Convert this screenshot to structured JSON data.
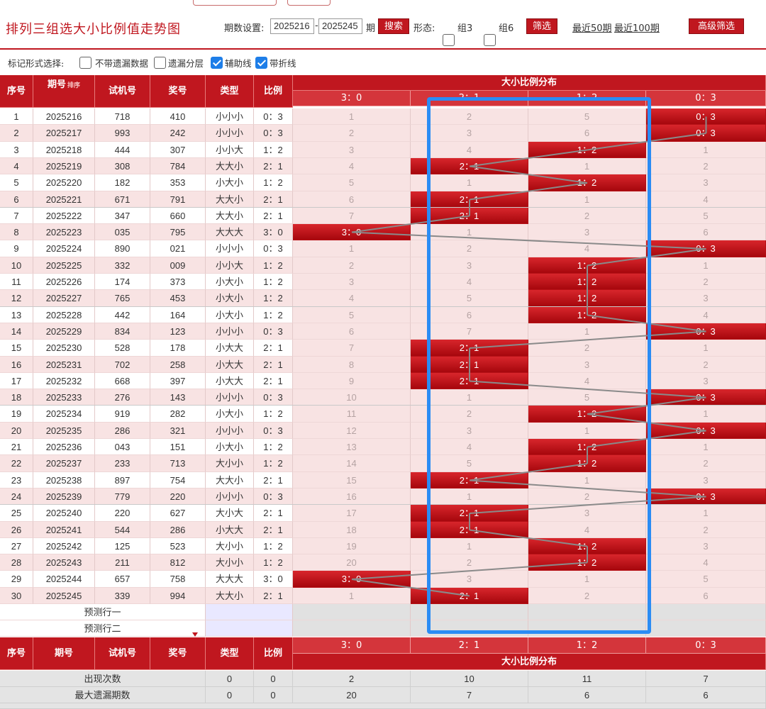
{
  "title": "排列三组选大小比例值走势图",
  "search": {
    "label": "期数设置:",
    "from": "2025216",
    "dash": "-",
    "to": "2025245",
    "unit": "期",
    "button": "搜索"
  },
  "form": {
    "label": "形态:",
    "options": [
      {
        "label": "组3",
        "checked": false
      },
      {
        "label": "组6",
        "checked": false
      }
    ],
    "filter_button": "筛选",
    "recent50": "最近50期",
    "recent100": "最近100期",
    "advanced_button": "高级筛选"
  },
  "marks": {
    "label": "标记形式选择:",
    "options": [
      {
        "label": "不带遗漏数据",
        "checked": false
      },
      {
        "label": "遗漏分层",
        "checked": false
      },
      {
        "label": "辅助线",
        "checked": true
      },
      {
        "label": "带折线",
        "checked": true
      }
    ]
  },
  "header": {
    "seq": "序号",
    "issue": "期号",
    "sort": "排序",
    "trial": "试机号",
    "prize": "奖号",
    "type": "类型",
    "ratio": "比例",
    "dist": "大小比例分布",
    "cols": [
      "3：0",
      "2：1",
      "1：2",
      "0：3"
    ]
  },
  "rows": [
    {
      "seq": "1",
      "issue": "2025216",
      "trial": "718",
      "prize": "410",
      "type": "小小小",
      "ratio": "0：3",
      "dist": [
        "1",
        "2",
        "5",
        "0：3"
      ]
    },
    {
      "seq": "2",
      "issue": "2025217",
      "trial": "993",
      "prize": "242",
      "type": "小小小",
      "ratio": "0：3",
      "dist": [
        "2",
        "3",
        "6",
        "0：3"
      ]
    },
    {
      "seq": "3",
      "issue": "2025218",
      "trial": "444",
      "prize": "307",
      "type": "小小大",
      "ratio": "1：2",
      "dist": [
        "3",
        "4",
        "1：2",
        "1"
      ]
    },
    {
      "seq": "4",
      "issue": "2025219",
      "trial": "308",
      "prize": "784",
      "type": "大大小",
      "ratio": "2：1",
      "dist": [
        "4",
        "2：1",
        "1",
        "2"
      ]
    },
    {
      "seq": "5",
      "issue": "2025220",
      "trial": "182",
      "prize": "353",
      "type": "小大小",
      "ratio": "1：2",
      "dist": [
        "5",
        "1",
        "1：2",
        "3"
      ]
    },
    {
      "seq": "6",
      "issue": "2025221",
      "trial": "671",
      "prize": "791",
      "type": "大大小",
      "ratio": "2：1",
      "dist": [
        "6",
        "2：1",
        "1",
        "4"
      ]
    },
    {
      "seq": "7",
      "issue": "2025222",
      "trial": "347",
      "prize": "660",
      "type": "大大小",
      "ratio": "2：1",
      "dist": [
        "7",
        "2：1",
        "2",
        "5"
      ]
    },
    {
      "seq": "8",
      "issue": "2025223",
      "trial": "035",
      "prize": "795",
      "type": "大大大",
      "ratio": "3：0",
      "dist": [
        "3：0",
        "1",
        "3",
        "6"
      ]
    },
    {
      "seq": "9",
      "issue": "2025224",
      "trial": "890",
      "prize": "021",
      "type": "小小小",
      "ratio": "0：3",
      "dist": [
        "1",
        "2",
        "4",
        "0：3"
      ]
    },
    {
      "seq": "10",
      "issue": "2025225",
      "trial": "332",
      "prize": "009",
      "type": "小小大",
      "ratio": "1：2",
      "dist": [
        "2",
        "3",
        "1：2",
        "1"
      ]
    },
    {
      "seq": "11",
      "issue": "2025226",
      "trial": "174",
      "prize": "373",
      "type": "小大小",
      "ratio": "1：2",
      "dist": [
        "3",
        "4",
        "1：2",
        "2"
      ]
    },
    {
      "seq": "12",
      "issue": "2025227",
      "trial": "765",
      "prize": "453",
      "type": "小大小",
      "ratio": "1：2",
      "dist": [
        "4",
        "5",
        "1：2",
        "3"
      ]
    },
    {
      "seq": "13",
      "issue": "2025228",
      "trial": "442",
      "prize": "164",
      "type": "小大小",
      "ratio": "1：2",
      "dist": [
        "5",
        "6",
        "1：2",
        "4"
      ]
    },
    {
      "seq": "14",
      "issue": "2025229",
      "trial": "834",
      "prize": "123",
      "type": "小小小",
      "ratio": "0：3",
      "dist": [
        "6",
        "7",
        "1",
        "0：3"
      ]
    },
    {
      "seq": "15",
      "issue": "2025230",
      "trial": "528",
      "prize": "178",
      "type": "小大大",
      "ratio": "2：1",
      "dist": [
        "7",
        "2：1",
        "2",
        "1"
      ]
    },
    {
      "seq": "16",
      "issue": "2025231",
      "trial": "702",
      "prize": "258",
      "type": "小大大",
      "ratio": "2：1",
      "dist": [
        "8",
        "2：1",
        "3",
        "2"
      ]
    },
    {
      "seq": "17",
      "issue": "2025232",
      "trial": "668",
      "prize": "397",
      "type": "小大大",
      "ratio": "2：1",
      "dist": [
        "9",
        "2：1",
        "4",
        "3"
      ]
    },
    {
      "seq": "18",
      "issue": "2025233",
      "trial": "276",
      "prize": "143",
      "type": "小小小",
      "ratio": "0：3",
      "dist": [
        "10",
        "1",
        "5",
        "0：3"
      ]
    },
    {
      "seq": "19",
      "issue": "2025234",
      "trial": "919",
      "prize": "282",
      "type": "小大小",
      "ratio": "1：2",
      "dist": [
        "11",
        "2",
        "1：2",
        "1"
      ]
    },
    {
      "seq": "20",
      "issue": "2025235",
      "trial": "286",
      "prize": "321",
      "type": "小小小",
      "ratio": "0：3",
      "dist": [
        "12",
        "3",
        "1",
        "0：3"
      ]
    },
    {
      "seq": "21",
      "issue": "2025236",
      "trial": "043",
      "prize": "151",
      "type": "小大小",
      "ratio": "1：2",
      "dist": [
        "13",
        "4",
        "1：2",
        "1"
      ]
    },
    {
      "seq": "22",
      "issue": "2025237",
      "trial": "233",
      "prize": "713",
      "type": "大小小",
      "ratio": "1：2",
      "dist": [
        "14",
        "5",
        "1：2",
        "2"
      ]
    },
    {
      "seq": "23",
      "issue": "2025238",
      "trial": "897",
      "prize": "754",
      "type": "大大小",
      "ratio": "2：1",
      "dist": [
        "15",
        "2：1",
        "1",
        "3"
      ]
    },
    {
      "seq": "24",
      "issue": "2025239",
      "trial": "779",
      "prize": "220",
      "type": "小小小",
      "ratio": "0：3",
      "dist": [
        "16",
        "1",
        "2",
        "0：3"
      ]
    },
    {
      "seq": "25",
      "issue": "2025240",
      "trial": "220",
      "prize": "627",
      "type": "大小大",
      "ratio": "2：1",
      "dist": [
        "17",
        "2：1",
        "3",
        "1"
      ]
    },
    {
      "seq": "26",
      "issue": "2025241",
      "trial": "544",
      "prize": "286",
      "type": "小大大",
      "ratio": "2：1",
      "dist": [
        "18",
        "2：1",
        "4",
        "2"
      ]
    },
    {
      "seq": "27",
      "issue": "2025242",
      "trial": "125",
      "prize": "523",
      "type": "大小小",
      "ratio": "1：2",
      "dist": [
        "19",
        "1",
        "1：2",
        "3"
      ]
    },
    {
      "seq": "28",
      "issue": "2025243",
      "trial": "211",
      "prize": "812",
      "type": "大小小",
      "ratio": "1：2",
      "dist": [
        "20",
        "2",
        "1：2",
        "4"
      ]
    },
    {
      "seq": "29",
      "issue": "2025244",
      "trial": "657",
      "prize": "758",
      "type": "大大大",
      "ratio": "3：0",
      "dist": [
        "3：0",
        "3",
        "1",
        "5"
      ]
    },
    {
      "seq": "30",
      "issue": "2025245",
      "trial": "339",
      "prize": "994",
      "type": "大大小",
      "ratio": "2：1",
      "dist": [
        "1",
        "2：1",
        "2",
        "6"
      ]
    }
  ],
  "predict": [
    "预测行一",
    "预测行二"
  ],
  "stats": [
    {
      "label": "出现次数",
      "type": "0",
      "ratio": "0",
      "cols": [
        "2",
        "10",
        "11",
        "7"
      ]
    },
    {
      "label": "最大遗漏期数",
      "type": "0",
      "ratio": "0",
      "cols": [
        "20",
        "7",
        "6",
        "6"
      ]
    }
  ],
  "colors": {
    "brand": "#c0171f",
    "highlight": "#2b8cf4",
    "zebra": "#f8e3e3",
    "line": "#8a8a8a"
  }
}
